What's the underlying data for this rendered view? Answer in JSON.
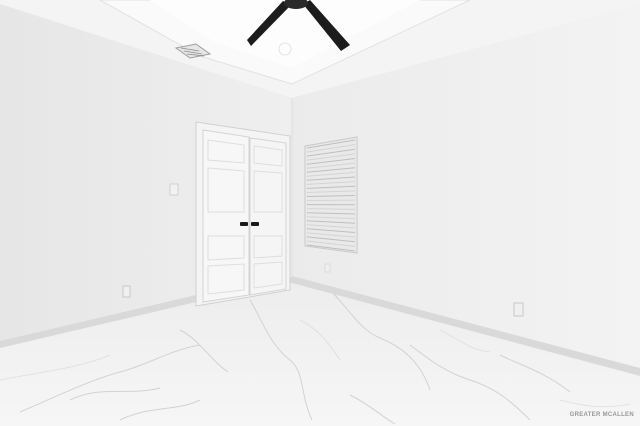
{
  "photo": {
    "subject": "empty-room-interior",
    "watermark_text": "GREATER MCALLEN",
    "colors": {
      "wall": "#ececec",
      "ceiling": "#f6f6f6",
      "floor": "#f1f1f1",
      "baseboard": "#d7d7d7",
      "fan": "#1c1c1c",
      "marble_vein": "#c9c9c9"
    }
  }
}
